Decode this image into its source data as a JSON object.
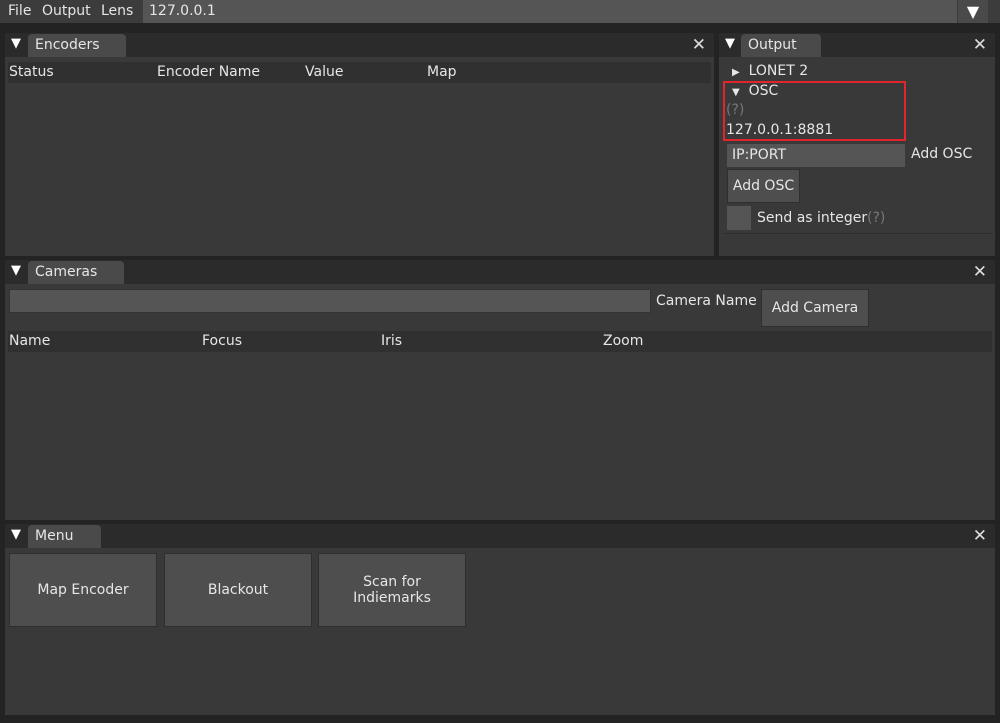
{
  "menubar": {
    "items": [
      "File",
      "Output",
      "Lens"
    ],
    "ip_value": "127.0.0.1",
    "dropdown_icon": "▼"
  },
  "encoders": {
    "title": "Encoders",
    "columns": [
      "Status",
      "Encoder Name",
      "Value",
      "Map"
    ]
  },
  "output": {
    "title": "Output",
    "lonet": "LONET 2",
    "osc": "OSC",
    "help": "(?)",
    "osc_address": "127.0.0.1:8881",
    "ip_placeholder": "IP:PORT",
    "ip_label": "Add OSC",
    "add_button": "Add OSC",
    "send_integer": "Send as integer",
    "send_help": "(?)",
    "highlight_color": "#e0262b"
  },
  "cameras": {
    "title": "Cameras",
    "name_label": "Camera Name",
    "add_button": "Add Camera",
    "columns": [
      "Name",
      "Focus",
      "Iris",
      "Zoom"
    ]
  },
  "menu": {
    "title": "Menu",
    "buttons": [
      "Map Encoder",
      "Blackout",
      "Scan for Indiemarks"
    ]
  }
}
